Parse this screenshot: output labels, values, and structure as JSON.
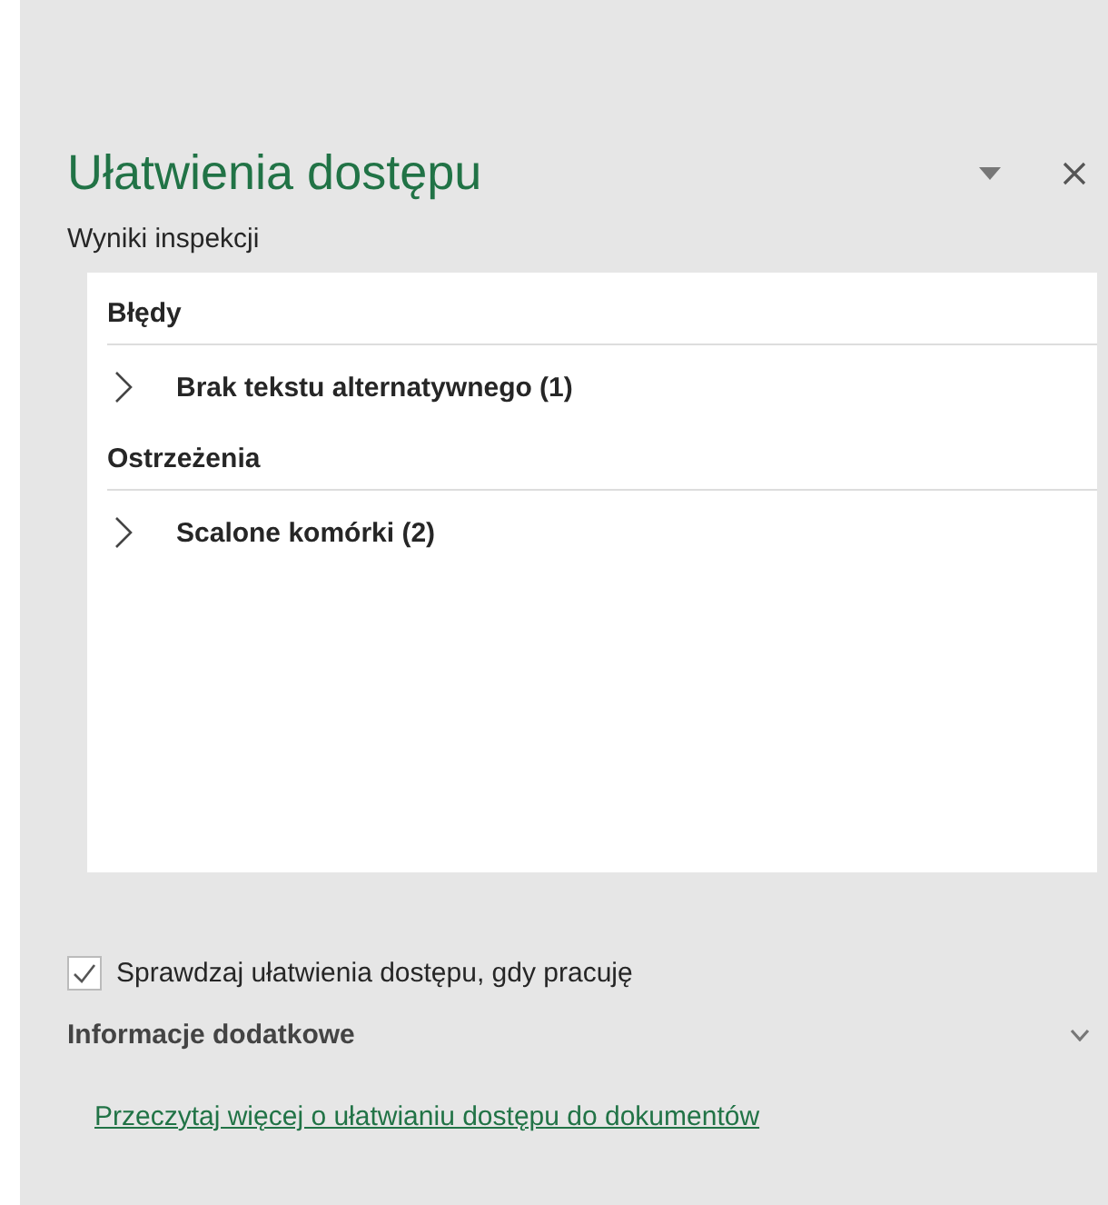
{
  "pane": {
    "title": "Ułatwienia dostępu",
    "subtitle": "Wyniki inspekcji"
  },
  "results": [
    {
      "heading": "Błędy",
      "items": [
        {
          "label": "Brak tekstu alternatywnego (1)",
          "expanded": false
        }
      ]
    },
    {
      "heading": "Ostrzeżenia",
      "items": [
        {
          "label": "Scalone komórki (2)",
          "expanded": false
        }
      ]
    }
  ],
  "check": {
    "label": "Sprawdzaj ułatwienia dostępu, gdy pracuję",
    "checked": true
  },
  "more_info": {
    "title": "Informacje dodatkowe",
    "expanded": false
  },
  "link": "Przeczytaj więcej o ułatwianiu dostępu do dokumentów"
}
